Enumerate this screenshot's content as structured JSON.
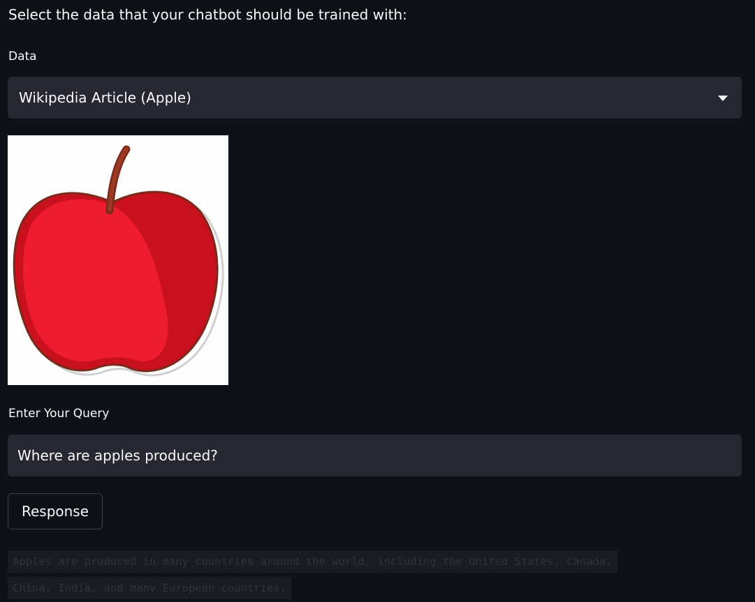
{
  "page": {
    "heading": "Select the data that your chatbot should be trained with:"
  },
  "data_select": {
    "label": "Data",
    "selected_value": "Wikipedia Article (Apple)",
    "icon": "chevron-down-icon"
  },
  "image": {
    "icon": "apple-icon",
    "colors": {
      "apple_red": "#ee1c2e",
      "apple_dark_red": "#c8101e",
      "outline": "#7a2a1a",
      "stem": "#9b3a24"
    }
  },
  "query": {
    "label": "Enter Your Query",
    "value": "Where are apples produced?"
  },
  "response_button": {
    "label": "Response"
  },
  "response": {
    "line1": "Apples are produced in many countries around the world, including the United States, Canada,",
    "line2": "China, India, and many European countries."
  },
  "colors": {
    "background": "#0e1117",
    "widget_background": "#262730",
    "text": "#fafafa"
  }
}
